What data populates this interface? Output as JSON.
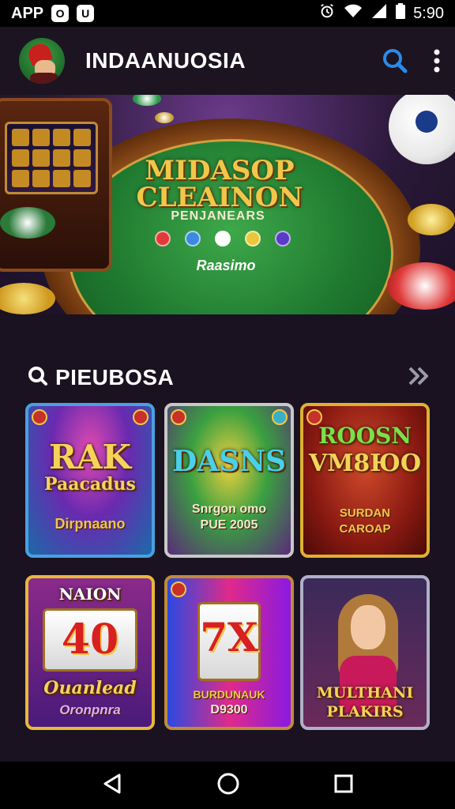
{
  "status_bar": {
    "app_label": "APP",
    "badge1": "O",
    "badge2": "U",
    "time": "5:90"
  },
  "app_bar": {
    "title": "INDAANUOSIA"
  },
  "hero": {
    "title_line1": "MIDASOP",
    "title_line2": "CLEAINON",
    "subtitle": "PENJANEARS",
    "tagline": "Raasimo",
    "chip_colors": [
      "#e23a3a",
      "#3a8ae0",
      "#ffffff",
      "#e8c83a",
      "#5a3ac8"
    ]
  },
  "section": {
    "title": "PIEUBOSA"
  },
  "games": [
    {
      "title": "RAK Paacadus",
      "subtitle": "Dirpnaano"
    },
    {
      "title": "DASNS",
      "subtitle": "Snrgon omo PUE 2005"
    },
    {
      "title": "ROOSN VM8ЮO",
      "subtitle": "SURDAN CAROAP"
    },
    {
      "title": "NAION 40 Ouanlead Oronpnra",
      "subtitle": ""
    },
    {
      "title": "7X",
      "subtitle": "BURDUNAUK D9300"
    },
    {
      "title": "MULTHANI PLAKIRS",
      "subtitle": ""
    }
  ],
  "games_display": {
    "g1_l1": "RAK",
    "g1_l2": "Paacadus",
    "g1_sub": "Dirpnaano",
    "g2_l1": "DASNS",
    "g2_sub1": "Snrgon omo",
    "g2_sub2": "PUE 2005",
    "g3_l1": "ROOSN",
    "g3_l2": "VM8ЮO",
    "g3_sub1": "SURDAN",
    "g3_sub2": "CAROAP",
    "g4_l1": "NAION",
    "g4_l2": "40",
    "g4_l3": "Ouanlead",
    "g4_l4": "Oronpnra",
    "g5_l1": "7X",
    "g5_sub1": "BURDUNAUK",
    "g5_sub2": "D9300",
    "g6_l1": "MULTHANI",
    "g6_l2": "PLAKIRS"
  },
  "icons": {
    "search": "search-icon",
    "more": "more-vert-icon",
    "forward": "double-chevron-right-icon",
    "back": "nav-back-icon",
    "home": "nav-home-icon",
    "recents": "nav-recents-icon"
  },
  "colors": {
    "accent_gold": "#f2c64a",
    "search_blue": "#2a8ae8",
    "background": "#1a1220"
  }
}
